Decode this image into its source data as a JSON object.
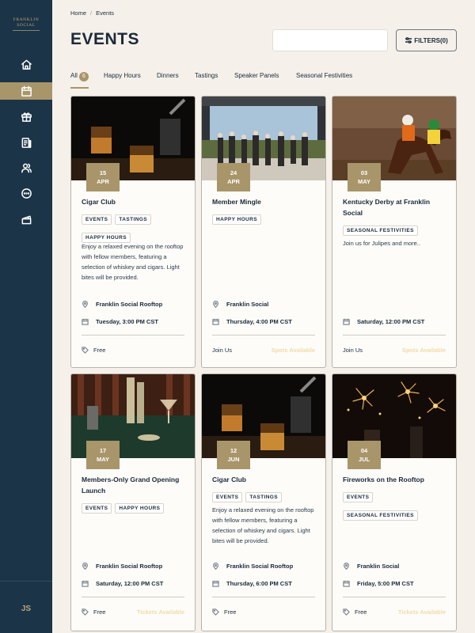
{
  "brand": {
    "line1": "FRANKLIN",
    "line2": "SOCIAL"
  },
  "breadcrumb": {
    "home": "Home",
    "sep": "/",
    "current": "Events"
  },
  "page_title": "EVENTS",
  "search": {
    "placeholder": ""
  },
  "filters_label": "FILTERS(0)",
  "user_initials": "JS",
  "sidebar": {
    "items": [
      {
        "icon": "home-icon"
      },
      {
        "icon": "calendar-icon",
        "active": true
      },
      {
        "icon": "gift-icon"
      },
      {
        "icon": "menu-icon"
      },
      {
        "icon": "members-icon"
      },
      {
        "icon": "chat-icon"
      },
      {
        "icon": "ticket-icon"
      }
    ]
  },
  "tabs": [
    {
      "label": "All",
      "count": "6",
      "active": true
    },
    {
      "label": "Happy Hours"
    },
    {
      "label": "Dinners"
    },
    {
      "label": "Tastings"
    },
    {
      "label": "Speaker Panels"
    },
    {
      "label": "Seasonal Festivities"
    }
  ],
  "cards": [
    {
      "day": "15",
      "month": "APR",
      "title": "Cigar Club",
      "tags": [
        "EVENTS",
        "TASTINGS",
        "HAPPY HOURS"
      ],
      "desc": "Enjoy a relaxed evening on the rooftop with fellow members, featuring a selection of whiskey and cigars. Light bites will be provided.",
      "location": "Franklin Social Rooftop",
      "time": "Tuesday, 3:00 PM CST",
      "foot_left": "Free",
      "foot_right": ""
    },
    {
      "day": "24",
      "month": "APR",
      "title": "Member Mingle",
      "tags": [
        "HAPPY HOURS"
      ],
      "desc": "",
      "location": "Franklin Social",
      "time": "Thursday, 4:00 PM CST",
      "foot_left": "Join Us",
      "foot_right": "Spots Available"
    },
    {
      "day": "03",
      "month": "MAY",
      "title": "Kentucky Derby at Franklin Social",
      "tags": [
        "SEASONAL FESTIVITIES"
      ],
      "desc": "Join us for Julipes and more..",
      "location": "",
      "time": "Saturday, 12:00 PM CST",
      "foot_left": "Join Us",
      "foot_right": "Spots Available"
    },
    {
      "day": "17",
      "month": "MAY",
      "title": "Members-Only Grand Opening Launch",
      "tags": [
        "EVENTS",
        "HAPPY HOURS"
      ],
      "desc": "",
      "location": "Franklin Social Rooftop",
      "time": "Saturday, 12:00 PM CST",
      "foot_left": "Free",
      "foot_right": "Tickets Available"
    },
    {
      "day": "12",
      "month": "JUN",
      "title": "Cigar Club",
      "tags": [
        "EVENTS",
        "TASTINGS"
      ],
      "desc": "Enjoy a relaxed evening on the rooftop with fellow members, featuring a selection of whiskey and cigars. Light bites will be provided.",
      "location": "Franklin Social Rooftop",
      "time": "Thursday, 6:00 PM CST",
      "foot_left": "Free",
      "foot_right": ""
    },
    {
      "day": "04",
      "month": "JUL",
      "title": "Fireworks on the Rooftop",
      "tags": [
        "EVENTS",
        "SEASONAL FESTIVITIES"
      ],
      "desc": "",
      "location": "Franklin Social",
      "time": "Friday, 5:00 PM CST",
      "foot_left": "Free",
      "foot_right": "Tickets Available"
    }
  ],
  "colors": {
    "sidebar": "#1b3448",
    "accent": "#a8956a",
    "availability": "#f0dca8",
    "background": "#f5f1ea"
  }
}
